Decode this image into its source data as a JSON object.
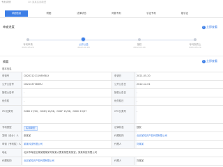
{
  "header": {
    "title": "专利详情",
    "subtitle": "CN 某某实用新型"
  },
  "tabs": [
    {
      "label": "详细信息",
      "active": true
    },
    {
      "label": "附图",
      "active": false
    },
    {
      "label": "法律状态",
      "active": false
    },
    {
      "label": "同族专利",
      "active": false
    },
    {
      "label": "引证专利",
      "active": false
    },
    {
      "label": "被引证",
      "active": false
    }
  ],
  "timeline": {
    "title": "审查进度",
    "action": {
      "icon": "plus-icon",
      "label": "立即查看"
    },
    "steps": [
      {
        "label": "专利申请",
        "date": "2021-05-20",
        "active": false
      },
      {
        "label": "公开公告",
        "date": "2022-01-18",
        "active": true
      },
      {
        "label": "授权",
        "date": "2022-03-24",
        "active": false
      },
      {
        "label": "专利权终止",
        "date": "2024-05-20",
        "active": false
      }
    ]
  },
  "info": {
    "title": "摘要",
    "action": {
      "icon": "plus-icon",
      "label": "立即查看"
    },
    "subtitle": "基本信息",
    "rows": [
      {
        "l1": "申请号",
        "v1": "CN2021211198958.X",
        "l2": "申请日",
        "v2": "2021-05-20"
      },
      {
        "l1": "公开公告号",
        "v1": "CN214373836U",
        "l2": "公开公告日",
        "v2": "2022-12-01"
      },
      {
        "l1": "授权公告号",
        "v1": "-",
        "l2": "授权公告日",
        "v2": "-"
      },
      {
        "l1": "优先权",
        "v1": "-",
        "l2": "优先权日",
        "v2": "-"
      },
      {
        "tall": true,
        "l1": "IPC分类号",
        "v1": "G06K 17/00、G06Q 10/08、G06F 13/38、G06K 19/07",
        "l2": "CPC分类号",
        "v2": "-"
      },
      {
        "l1": "专利类型",
        "v1": "实用新型",
        "badge": true,
        "l2": "法律状态",
        "v2": "授权"
      },
      {
        "l1": "发明（设计）人",
        "v1": "张某某",
        "l2": "代理机构",
        "v2": "北京某知识产权代理有限公司",
        "link2": true
      },
      {
        "l1": "申请（专利权）人",
        "v1": "某某科技有限公司",
        "link1": true,
        "l2": "代理人",
        "v2": "刘某某",
        "link2": true
      },
      {
        "full": true,
        "l1": "地址",
        "v1": "北京市海淀区某某路某某号某某大厦某某层某某室；某某科技有限公司"
      },
      {
        "l1": "代理机构",
        "v1": "北京某知识产权代理有限公司",
        "link1": true,
        "l2": "代理人",
        "v2": "刘某某"
      }
    ]
  }
}
